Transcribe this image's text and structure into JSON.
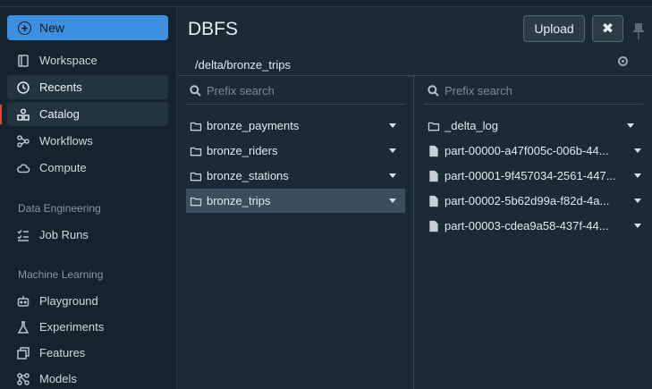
{
  "sidebar": {
    "new_label": "New",
    "items": [
      {
        "label": "Workspace",
        "icon": "workspace-icon"
      },
      {
        "label": "Recents",
        "icon": "clock-icon"
      },
      {
        "label": "Catalog",
        "icon": "catalog-icon"
      },
      {
        "label": "Workflows",
        "icon": "workflows-icon"
      },
      {
        "label": "Compute",
        "icon": "cloud-icon"
      }
    ],
    "sections": [
      {
        "title": "Data Engineering",
        "items": [
          {
            "label": "Job Runs",
            "icon": "job-runs-icon"
          }
        ]
      },
      {
        "title": "Machine Learning",
        "items": [
          {
            "label": "Playground",
            "icon": "robot-icon"
          },
          {
            "label": "Experiments",
            "icon": "flask-icon"
          },
          {
            "label": "Features",
            "icon": "features-icon"
          },
          {
            "label": "Models",
            "icon": "models-icon"
          }
        ]
      }
    ]
  },
  "header": {
    "title": "DBFS",
    "upload_label": "Upload",
    "close_label": "✖",
    "path": "/delta/bronze_trips"
  },
  "left_pane": {
    "search_placeholder": "Prefix search",
    "items": [
      "bronze_payments",
      "bronze_riders",
      "bronze_stations",
      "bronze_trips"
    ],
    "selected": "bronze_trips"
  },
  "right_pane": {
    "search_placeholder": "Prefix search",
    "items": [
      {
        "label": "_delta_log",
        "type": "folder"
      },
      {
        "label": "part-00000-a47f005c-006b-44...",
        "type": "file"
      },
      {
        "label": "part-00001-9f457034-2561-447...",
        "type": "file"
      },
      {
        "label": "part-00002-5b62d99a-f82d-4a...",
        "type": "file"
      },
      {
        "label": "part-00003-cdea9a58-437f-44...",
        "type": "file"
      }
    ]
  },
  "colors": {
    "accent": "#3d8fe0",
    "sidebar_bg": "#15232c",
    "main_bg": "#1b2b35",
    "selected_row": "#3a4f5b",
    "catalog_marker": "#e0453a"
  }
}
